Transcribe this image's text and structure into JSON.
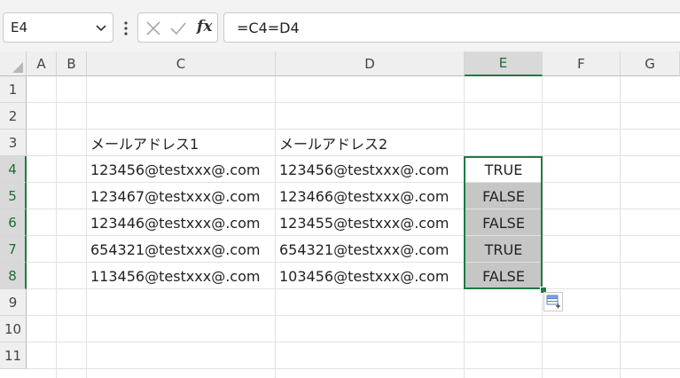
{
  "formula_bar": {
    "name_box": "E4",
    "formula": "=C4=D4",
    "fx_label": "fx"
  },
  "columns": [
    "A",
    "B",
    "C",
    "D",
    "E",
    "F",
    "G"
  ],
  "selected_column": "E",
  "rows": [
    "1",
    "2",
    "3",
    "4",
    "5",
    "6",
    "7",
    "8",
    "9",
    "10",
    "11"
  ],
  "selected_rows": [
    "4",
    "5",
    "6",
    "7",
    "8"
  ],
  "cells": {
    "C3": "メールアドレス1",
    "D3": "メールアドレス2",
    "C4": "123456@testxxx@.com",
    "D4": "123456@testxxx@.com",
    "E4": "TRUE",
    "C5": "123467@testxxx@.com",
    "D5": "123466@testxxx@.com",
    "E5": "FALSE",
    "C6": "123446@testxxx@.com",
    "D6": "123455@testxxx@.com",
    "E6": "FALSE",
    "C7": "654321@testxxx@.com",
    "D7": "654321@testxxx@.com",
    "E7": "TRUE",
    "C8": "113456@testxxx@.com",
    "D8": "103456@testxxx@.com",
    "E8": "FALSE"
  },
  "icons": {
    "name_box_dropdown": "chevron-down-icon",
    "more": "vertical-dots-icon",
    "cancel": "cross-icon",
    "enter": "check-icon",
    "insert_function": "fx-icon",
    "quick_analysis": "quick-analysis-icon"
  },
  "colors": {
    "selection_border": "#1f7a45",
    "selection_fill": "#c6c6c6",
    "header_bg": "#efefef"
  }
}
